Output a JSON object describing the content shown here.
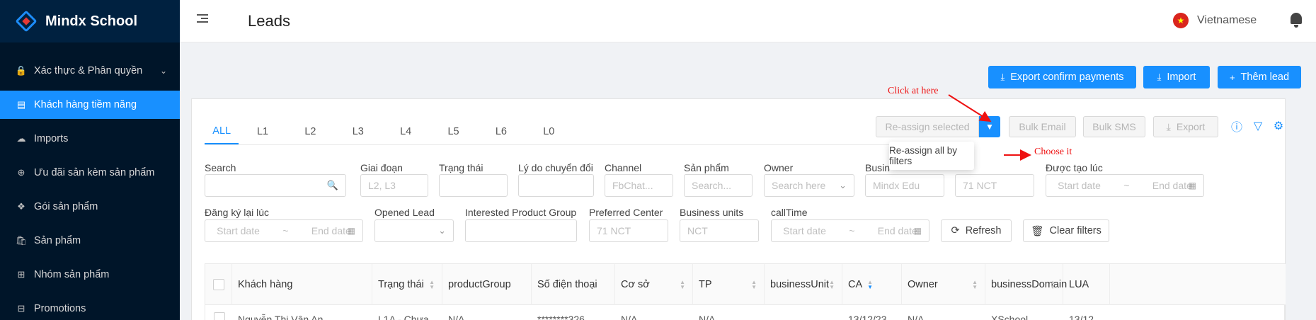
{
  "app": {
    "name": "Mindx School"
  },
  "sidebar": {
    "items": [
      {
        "label": "Xác thực & Phân quyền",
        "icon": "lock-icon",
        "glyph": "🔒",
        "expand": "⌄"
      },
      {
        "label": "Khách hàng tiềm năng",
        "icon": "contacts-icon",
        "glyph": "▤"
      },
      {
        "label": "Imports",
        "icon": "cloud-upload-icon",
        "glyph": "☁"
      },
      {
        "label": "Ưu đãi sản kèm sản phẩm",
        "icon": "plus-circle-icon",
        "glyph": "⊕"
      },
      {
        "label": "Gói sản phẩm",
        "icon": "dropbox-icon",
        "glyph": "❖"
      },
      {
        "label": "Sản phẩm",
        "icon": "shopping-icon",
        "glyph": "🛍"
      },
      {
        "label": "Nhóm sản phẩm",
        "icon": "table-icon",
        "glyph": "⊞"
      },
      {
        "label": "Promotions",
        "icon": "gift-icon",
        "glyph": "⊟"
      }
    ]
  },
  "header": {
    "title": "Leads",
    "language": "Vietnamese",
    "flag": "★"
  },
  "toolbar": {
    "export_confirm": "Export confirm payments",
    "import": "Import",
    "add_lead": "Thêm lead",
    "export_icon": "⤓",
    "plus_icon": "+"
  },
  "tabs": [
    "ALL",
    "L1",
    "L2",
    "L3",
    "L4",
    "L5",
    "L6",
    "L0"
  ],
  "actions": {
    "reassign": "Re-assign selected",
    "reassign_all": "Re-assign all by filters",
    "bulk_email": "Bulk Email",
    "bulk_sms": "Bulk SMS",
    "export": "Export"
  },
  "filters": {
    "search": {
      "label": "Search",
      "placeholder": ""
    },
    "giai_doan": {
      "label": "Giai đoạn",
      "placeholder": "L2, L3"
    },
    "trang_thai": {
      "label": "Trạng thái",
      "placeholder": ""
    },
    "ly_do": {
      "label": "Lý do chuyển đổi",
      "placeholder": ""
    },
    "channel": {
      "label": "Channel",
      "placeholder": "FbChat..."
    },
    "san_pham": {
      "label": "Sản phẩm",
      "placeholder": "Search..."
    },
    "owner": {
      "label": "Owner",
      "placeholder": "Search here"
    },
    "business": {
      "label": "Busin",
      "placeholder": "Mindx Edu"
    },
    "center_value": {
      "placeholder": "71 NCT"
    },
    "duoc_tao_luc": {
      "label": "Được tạo lúc",
      "start": "Start date",
      "end": "End date"
    },
    "dang_ky_lai": {
      "label": "Đăng ký lại lúc",
      "start": "Start date",
      "end": "End date"
    },
    "opened_lead": {
      "label": "Opened Lead"
    },
    "interested_group": {
      "label": "Interested Product Group"
    },
    "preferred_center": {
      "label": "Preferred Center",
      "placeholder": "71 NCT"
    },
    "business_units": {
      "label": "Business units",
      "placeholder": "NCT"
    },
    "calltime": {
      "label": "callTime",
      "start": "Start date",
      "end": "End date"
    },
    "range_sep": "~",
    "refresh": "Refresh",
    "clear": "Clear filters"
  },
  "table": {
    "columns": [
      "Khách hàng",
      "Trạng thái",
      "productGroup",
      "Số điện thoại",
      "Cơ sở",
      "TP",
      "businessUnit",
      "CA",
      "Owner",
      "businessDomain",
      "LUA"
    ],
    "row": [
      "Nguyễn Thị Vân An",
      "L1A - Chưa ...",
      "N/A",
      "********326",
      "N/A",
      "N/A",
      "",
      "13/12/23",
      "N/A",
      "XSchool",
      "13/12"
    ]
  },
  "annotations": {
    "click": "Click at here",
    "choose": "Choose it"
  },
  "colors": {
    "primary": "#1890ff",
    "sidebar": "#001529",
    "annotation": "#ee1111"
  }
}
